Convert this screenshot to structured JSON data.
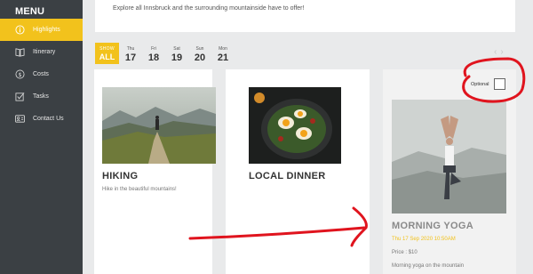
{
  "sidebar": {
    "title": "MENU",
    "items": [
      {
        "label": "Highlights",
        "icon": "info-icon",
        "active": true
      },
      {
        "label": "Itinerary",
        "icon": "book-icon",
        "active": false
      },
      {
        "label": "Costs",
        "icon": "dollar-icon",
        "active": false
      },
      {
        "label": "Tasks",
        "icon": "checkbox-icon",
        "active": false
      },
      {
        "label": "Contact Us",
        "icon": "contact-icon",
        "active": false
      }
    ]
  },
  "intro": {
    "text": "Explore all Innsbruck and the surrounding mountainside have to offer!"
  },
  "dates": {
    "show_all_top": "SHOW",
    "show_all_bottom": "ALL",
    "days": [
      {
        "name": "Thu",
        "num": "17"
      },
      {
        "name": "Fri",
        "num": "18"
      },
      {
        "name": "Sat",
        "num": "19"
      },
      {
        "name": "Sun",
        "num": "20"
      },
      {
        "name": "Mon",
        "num": "21"
      }
    ],
    "prev_arrow": "‹",
    "next_arrow": "›"
  },
  "cards": {
    "hiking": {
      "title": "HIKING",
      "desc": "Hike in the beautiful mountains!"
    },
    "dinner": {
      "title": "LOCAL DINNER"
    },
    "yoga": {
      "optional_label": "Optional",
      "title": "MORNING YOGA",
      "date": "Thu 17 Sep 2020 10:50AM",
      "price": "Price : $10",
      "desc": "Morning yoga on the mountain"
    }
  },
  "colors": {
    "accent": "#f2c21c",
    "sidebar_bg": "#3b4044",
    "annotation": "#e0141e"
  }
}
